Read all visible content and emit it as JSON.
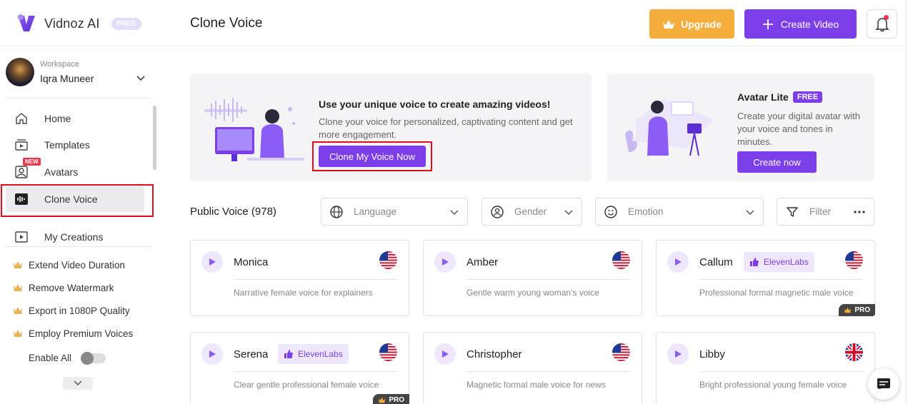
{
  "app": {
    "name": "Vidnoz AI",
    "plan_badge": "FREE"
  },
  "header": {
    "title": "Clone Voice",
    "upgrade_label": "Upgrade",
    "create_video_label": "Create Video"
  },
  "workspace": {
    "label": "Workspace",
    "name": "Iqra Muneer"
  },
  "sidebar": {
    "items": [
      {
        "label": "Home",
        "icon": "home-icon"
      },
      {
        "label": "Templates",
        "icon": "templates-icon"
      },
      {
        "label": "Avatars",
        "icon": "avatar-icon",
        "badge": "NEW"
      },
      {
        "label": "Clone Voice",
        "icon": "voice-wave-icon",
        "active": true
      },
      {
        "label": "My Creations",
        "icon": "play-icon"
      }
    ],
    "perks": [
      "Extend Video Duration",
      "Remove Watermark",
      "Export in 1080P Quality",
      "Employ Premium Voices"
    ],
    "enable_all_label": "Enable All",
    "enable_all_on": false
  },
  "clone_banner": {
    "title": "Use your unique voice to create amazing videos!",
    "description": "Clone your voice for personalized, captivating content and get more engagement.",
    "button": "Clone My Voice Now"
  },
  "avatar_banner": {
    "title": "Avatar Lite",
    "badge": "FREE",
    "description": "Create your digital avatar with your voice and tones in minutes.",
    "button": "Create now"
  },
  "public_voice": {
    "title": "Public Voice (978)",
    "filters": {
      "language": "Language",
      "gender": "Gender",
      "emotion": "Emotion",
      "filter": "Filter"
    }
  },
  "voices": [
    {
      "name": "Monica",
      "description": "Narrative female voice for explainers",
      "flag": "us-flag",
      "provider": "",
      "pro": false
    },
    {
      "name": "Amber",
      "description": "Gentle warm young woman's voice",
      "flag": "us-flag",
      "provider": "",
      "pro": false
    },
    {
      "name": "Callum",
      "description": "Professional formal magnetic male voice",
      "flag": "us-flag",
      "provider": "ElevenLabs",
      "pro": true,
      "pro_label": "PRO"
    },
    {
      "name": "Serena",
      "description": "Clear gentle professional female voice",
      "flag": "us-flag",
      "provider": "ElevenLabs",
      "pro": true,
      "pro_label": "PRO"
    },
    {
      "name": "Christopher",
      "description": "Magnetic formal male voice for news",
      "flag": "us-flag",
      "provider": "",
      "pro": false
    },
    {
      "name": "Libby",
      "description": "Bright professional young female voice",
      "flag": "uk-flag",
      "provider": "",
      "pro": false
    }
  ],
  "colors": {
    "accent": "#7b3ee8",
    "upgrade": "#f5ad3b",
    "highlight_box": "#e00d1a"
  }
}
